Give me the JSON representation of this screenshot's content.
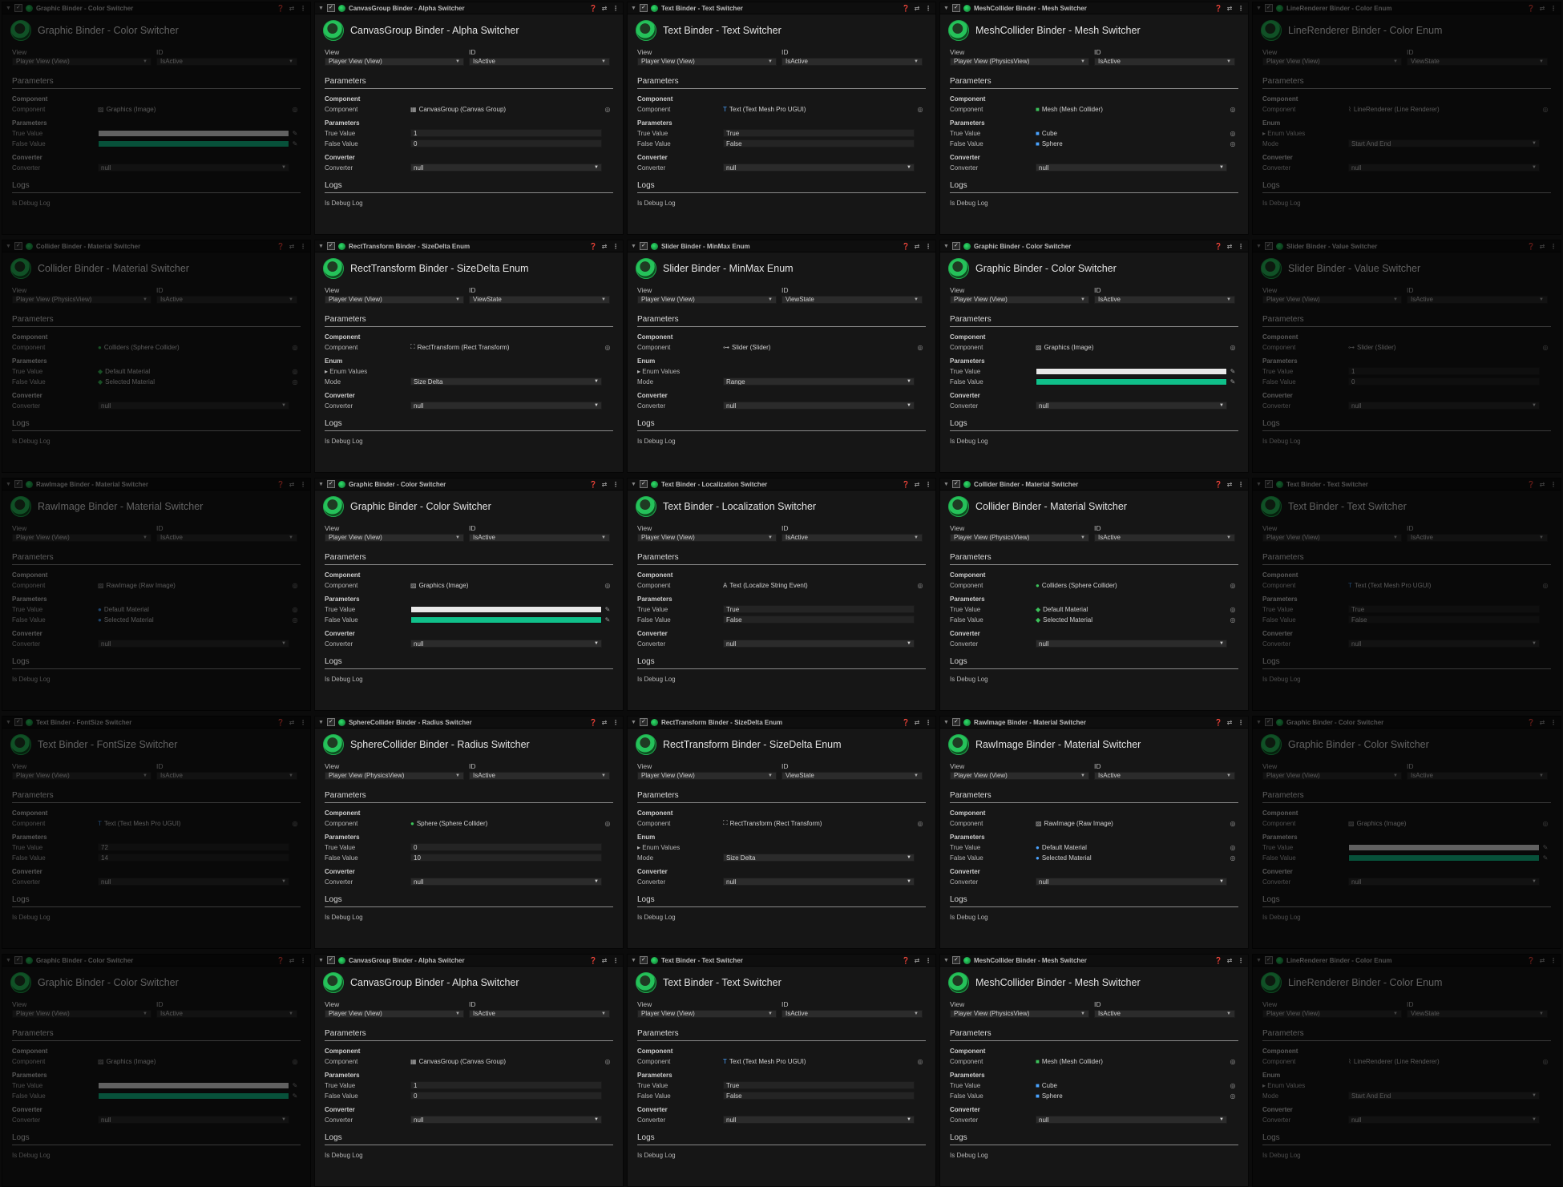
{
  "labels": {
    "view": "View",
    "id": "ID",
    "parameters": "Parameters",
    "component_section": "Component",
    "component": "Component",
    "parameters_sub": "Parameters",
    "enum_sub": "Enum",
    "true_value": "True Value",
    "false_value": "False Value",
    "enum_values": "▸ Enum Values",
    "mode": "Mode",
    "converter_section": "Converter",
    "converter": "Converter",
    "logs": "Logs",
    "is_debug_log": "Is Debug Log"
  },
  "colors": {
    "accent_green": "#25c25a",
    "true_color_white": "#e8e8e8",
    "false_color_green": "#10c08a"
  },
  "panels": [
    {
      "title": "Graphic Binder - Color Switcher",
      "dim": true,
      "view": "Player View (View)",
      "id": "IsActive",
      "component": "Graphics (Image)",
      "component_icon": "image-icon",
      "type": "color",
      "converter": "null"
    },
    {
      "title": "CanvasGroup Binder - Alpha Switcher",
      "dim": false,
      "view": "Player View (View)",
      "id": "IsActive",
      "component": "CanvasGroup (Canvas Group)",
      "component_icon": "canvas-group-icon",
      "type": "text",
      "true_value": "1",
      "false_value": "0",
      "converter": "null"
    },
    {
      "title": "Text Binder - Text Switcher",
      "dim": false,
      "view": "Player View (View)",
      "id": "IsActive",
      "component": "Text (Text Mesh Pro UGUI)",
      "component_icon": "text-icon",
      "type": "text",
      "true_value": "True",
      "false_value": "False",
      "converter": "null"
    },
    {
      "title": "MeshCollider Binder - Mesh Switcher",
      "dim": false,
      "view": "Player View (PhysicsView)",
      "id": "IsActive",
      "component": "Mesh (Mesh Collider)",
      "component_icon": "mesh-collider-icon",
      "type": "object",
      "true_value": "Cube",
      "false_value": "Sphere",
      "true_icon": "mesh-icon",
      "false_icon": "mesh-icon",
      "converter": "null"
    },
    {
      "title": "LineRenderer Binder - Color Enum",
      "dim": true,
      "view": "Player View (View)",
      "id": "ViewState",
      "component": "LineRenderer (Line Renderer)",
      "component_icon": "line-renderer-icon",
      "type": "enum",
      "mode": "Start And End",
      "converter": "null"
    },
    {
      "title": "Collider Binder - Material Switcher",
      "dim": true,
      "view": "Player View (PhysicsView)",
      "id": "IsActive",
      "component": "Colliders (Sphere Collider)",
      "component_icon": "sphere-collider-icon",
      "type": "object",
      "true_value": "Default Material",
      "false_value": "Selected Material",
      "true_icon": "physic-material-icon",
      "false_icon": "physic-material-icon",
      "converter": "null"
    },
    {
      "title": "RectTransform Binder - SizeDelta Enum",
      "dim": false,
      "view": "Player View (View)",
      "id": "ViewState",
      "component": "RectTransform (Rect Transform)",
      "component_icon": "rect-transform-icon",
      "type": "enum",
      "mode": "Size Delta",
      "converter": "null"
    },
    {
      "title": "Slider Binder - MinMax Enum",
      "dim": false,
      "view": "Player View (View)",
      "id": "ViewState",
      "component": "Slider (Slider)",
      "component_icon": "slider-icon",
      "type": "enum",
      "mode": "Range",
      "converter": "null"
    },
    {
      "title": "Graphic Binder - Color Switcher",
      "dim": false,
      "view": "Player View (View)",
      "id": "IsActive",
      "component": "Graphics (Image)",
      "component_icon": "image-icon",
      "type": "color",
      "converter": "null"
    },
    {
      "title": "Slider Binder - Value Switcher",
      "dim": true,
      "view": "Player View (View)",
      "id": "IsActive",
      "component": "Slider (Slider)",
      "component_icon": "slider-icon",
      "type": "text",
      "true_value": "1",
      "false_value": "0",
      "converter": "null"
    },
    {
      "title": "RawImage Binder - Material Switcher",
      "dim": true,
      "view": "Player View (View)",
      "id": "IsActive",
      "component": "RawImage (Raw Image)",
      "component_icon": "raw-image-icon",
      "type": "object",
      "true_value": "Default Material",
      "false_value": "Selected Material",
      "true_icon": "material-icon",
      "false_icon": "material-icon",
      "converter": "null"
    },
    {
      "title": "Graphic Binder - Color Switcher",
      "dim": false,
      "view": "Player View (View)",
      "id": "IsActive",
      "component": "Graphics (Image)",
      "component_icon": "image-icon",
      "type": "color",
      "converter": "null"
    },
    {
      "title": "Text Binder - Localization Switcher",
      "dim": false,
      "view": "Player View (View)",
      "id": "IsActive",
      "component": "Text (Localize String Event)",
      "component_icon": "localize-icon",
      "type": "text",
      "true_value": "True",
      "false_value": "False",
      "converter": "null"
    },
    {
      "title": "Collider Binder - Material Switcher",
      "dim": false,
      "view": "Player View (PhysicsView)",
      "id": "IsActive",
      "component": "Colliders (Sphere Collider)",
      "component_icon": "sphere-collider-icon",
      "type": "object",
      "true_value": "Default Material",
      "false_value": "Selected Material",
      "true_icon": "physic-material-icon",
      "false_icon": "physic-material-icon",
      "converter": "null"
    },
    {
      "title": "Text Binder - Text Switcher",
      "dim": true,
      "view": "Player View (View)",
      "id": "IsActive",
      "component": "Text (Text Mesh Pro UGUI)",
      "component_icon": "text-icon",
      "type": "text",
      "true_value": "True",
      "false_value": "False",
      "converter": "null"
    },
    {
      "title": "Text Binder - FontSize Switcher",
      "dim": true,
      "view": "Player View (View)",
      "id": "IsActive",
      "component": "Text (Text Mesh Pro UGUI)",
      "component_icon": "text-icon",
      "type": "text",
      "true_value": "72",
      "false_value": "14",
      "converter": "null"
    },
    {
      "title": "SphereCollider Binder - Radius Switcher",
      "dim": false,
      "view": "Player View (PhysicsView)",
      "id": "IsActive",
      "component": "Sphere (Sphere Collider)",
      "component_icon": "sphere-collider-icon",
      "type": "text",
      "true_value": "0",
      "false_value": "10",
      "converter": "null"
    },
    {
      "title": "RectTransform Binder - SizeDelta Enum",
      "dim": false,
      "view": "Player View (View)",
      "id": "ViewState",
      "component": "RectTransform (Rect Transform)",
      "component_icon": "rect-transform-icon",
      "type": "enum",
      "mode": "Size Delta",
      "converter": "null"
    },
    {
      "title": "RawImage Binder - Material Switcher",
      "dim": false,
      "view": "Player View (View)",
      "id": "IsActive",
      "component": "RawImage (Raw Image)",
      "component_icon": "raw-image-icon",
      "type": "object",
      "true_value": "Default Material",
      "false_value": "Selected Material",
      "true_icon": "material-icon",
      "false_icon": "material-icon",
      "converter": "null"
    },
    {
      "title": "Graphic Binder - Color Switcher",
      "dim": true,
      "view": "Player View (View)",
      "id": "IsActive",
      "component": "Graphics (Image)",
      "component_icon": "image-icon",
      "type": "color",
      "converter": "null"
    },
    {
      "title": "Graphic Binder - Color Switcher",
      "dim": true,
      "view": "Player View (View)",
      "id": "IsActive",
      "component": "Graphics (Image)",
      "component_icon": "image-icon",
      "type": "color",
      "converter": "null"
    },
    {
      "title": "CanvasGroup Binder - Alpha Switcher",
      "dim": false,
      "view": "Player View (View)",
      "id": "IsActive",
      "component": "CanvasGroup (Canvas Group)",
      "component_icon": "canvas-group-icon",
      "type": "text",
      "true_value": "1",
      "false_value": "0",
      "converter": "null"
    },
    {
      "title": "Text Binder - Text Switcher",
      "dim": false,
      "view": "Player View (View)",
      "id": "IsActive",
      "component": "Text (Text Mesh Pro UGUI)",
      "component_icon": "text-icon",
      "type": "text",
      "true_value": "True",
      "false_value": "False",
      "converter": "null"
    },
    {
      "title": "MeshCollider Binder - Mesh Switcher",
      "dim": false,
      "view": "Player View (PhysicsView)",
      "id": "IsActive",
      "component": "Mesh (Mesh Collider)",
      "component_icon": "mesh-collider-icon",
      "type": "object",
      "true_value": "Cube",
      "false_value": "Sphere",
      "true_icon": "mesh-icon",
      "false_icon": "mesh-icon",
      "converter": "null"
    },
    {
      "title": "LineRenderer Binder - Color Enum",
      "dim": true,
      "view": "Player View (View)",
      "id": "ViewState",
      "component": "LineRenderer (Line Renderer)",
      "component_icon": "line-renderer-icon",
      "type": "enum",
      "mode": "Start And End",
      "converter": "null"
    }
  ]
}
